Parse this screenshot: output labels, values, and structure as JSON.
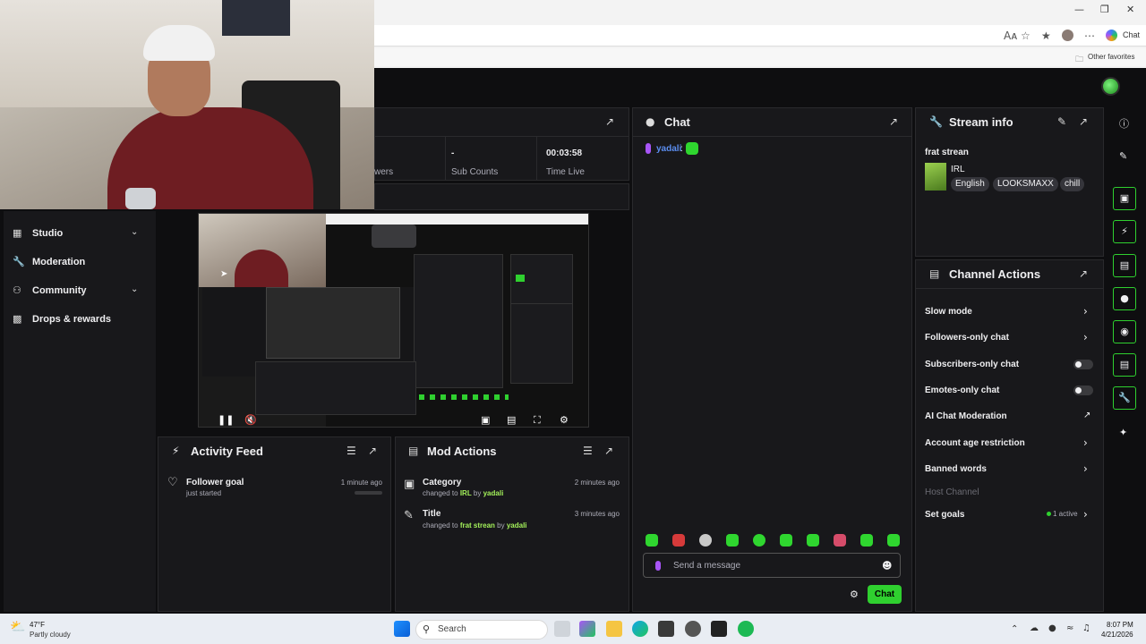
{
  "browser": {
    "read_aloud": "Aᴀ",
    "chat_label": "Chat",
    "favorites": "Other favorites"
  },
  "stats": [
    {
      "value": "",
      "label": "wers"
    },
    {
      "value": "-",
      "label": "Sub Counts"
    },
    {
      "value": "00:03:58",
      "label": "Time Live"
    }
  ],
  "sidebar": {
    "items": [
      {
        "label": "Studio",
        "icon": "studio-icon",
        "has_chevron": true
      },
      {
        "label": "Moderation",
        "icon": "wrench-icon",
        "has_chevron": false
      },
      {
        "label": "Community",
        "icon": "community-icon",
        "has_chevron": true
      },
      {
        "label": "Drops & rewards",
        "icon": "drops-icon",
        "has_chevron": false
      }
    ]
  },
  "activity_feed": {
    "title": "Activity Feed",
    "items": [
      {
        "title": "Follower goal",
        "sub": "just started",
        "time": "1 minute ago"
      }
    ]
  },
  "mod_actions": {
    "title": "Mod Actions",
    "items": [
      {
        "title": "Category",
        "prefix": "changed to ",
        "value": "IRL",
        "mid": " by ",
        "user": "yadali",
        "time": "2 minutes ago"
      },
      {
        "title": "Title",
        "prefix": "changed to ",
        "value": "frat strean",
        "mid": " by ",
        "user": "yadali",
        "time": "3 minutes ago"
      }
    ]
  },
  "chat": {
    "title": "Chat",
    "messages": [
      {
        "user": "yadali",
        "sep": ":"
      }
    ],
    "input_placeholder": "Send a message",
    "send_label": "Chat"
  },
  "stream_info": {
    "title": "Stream info",
    "stream_title": "frat strean",
    "category": "IRL",
    "tags": [
      "English",
      "LOOKSMAXX",
      "chill"
    ]
  },
  "channel_actions": {
    "title": "Channel Actions",
    "rows": [
      {
        "label": "Slow mode",
        "control": "chevron"
      },
      {
        "label": "Followers-only chat",
        "control": "chevron"
      },
      {
        "label": "Subscribers-only chat",
        "control": "toggle"
      },
      {
        "label": "Emotes-only chat",
        "control": "toggle"
      },
      {
        "label": "AI Chat Moderation",
        "control": "external"
      },
      {
        "label": "Account age restriction",
        "control": "chevron"
      },
      {
        "label": "Banned words",
        "control": "chevron"
      },
      {
        "label": "Host Channel",
        "control": "disabled"
      },
      {
        "label": "Set goals",
        "control": "chevron",
        "badge": "1 active"
      }
    ]
  },
  "taskbar": {
    "weather_temp": "47°F",
    "weather_desc": "Partly cloudy",
    "search_placeholder": "Search",
    "time": "8:07 PM",
    "date": "4/21/2026"
  },
  "colors": {
    "accent": "#2fd02f",
    "username": "#a3f05a",
    "chat_user": "#5b8def",
    "panel_bg": "#18181b",
    "page_bg": "#0e0e10"
  }
}
